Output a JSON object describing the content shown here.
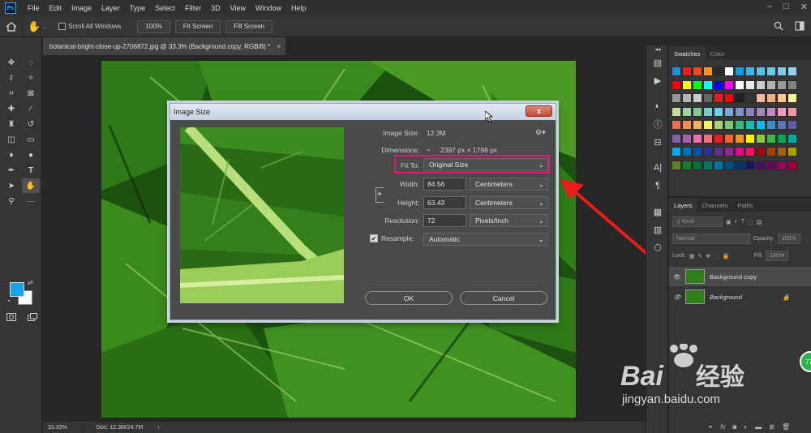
{
  "menubar": {
    "logo": "Ps",
    "items": [
      "File",
      "Edit",
      "Image",
      "Layer",
      "Type",
      "Select",
      "Filter",
      "3D",
      "View",
      "Window",
      "Help"
    ]
  },
  "options": {
    "scroll_all_windows": "Scroll All Windows",
    "zoom_btn": "100%",
    "fit_screen": "Fit Screen",
    "fill_screen": "Fill Screen"
  },
  "document": {
    "tab_title": "botanical-bright-close-up-2706872.jpg @ 33.3% (Background copy, RGB/8) *",
    "close": "×"
  },
  "status": {
    "zoom": "33.33%",
    "doc": "Doc: 12.3M/24.7M",
    "arrow": "›"
  },
  "dialog": {
    "title": "Image Size",
    "close": "x",
    "image_size_label": "Image Size:",
    "image_size_value": "12.3M",
    "dimensions_label": "Dimensions:",
    "dimensions_value": "2397 px  ×  1798 px",
    "fit_to_label": "Fit To:",
    "fit_to_value": "Original Size",
    "width_label": "Width:",
    "width_value": "84.56",
    "width_unit": "Centimeters",
    "height_label": "Height:",
    "height_value": "63.43",
    "height_unit": "Centimeters",
    "resolution_label": "Resolution:",
    "resolution_value": "72",
    "resolution_unit": "Pixels/Inch",
    "resample_label": "Resample:",
    "resample_value": "Automatic",
    "ok": "OK",
    "cancel": "Cancel"
  },
  "panels": {
    "tab_swatches": "Swatches",
    "tab_color": "Color",
    "tab_layers": "Layers",
    "tab_channels": "Channels",
    "tab_paths": "Paths",
    "kind": "Kind",
    "blend_mode": "Normal",
    "opacity_label": "Opacity:",
    "opacity_value": "100%",
    "lock_label": "Lock:",
    "fill_label": "Fill:",
    "fill_value": "100%",
    "layers": [
      {
        "name": "Background copy",
        "selected": true
      },
      {
        "name": "Background",
        "selected": false
      }
    ]
  },
  "watermark": {
    "brand": "Bai",
    "brand_cn": "经验",
    "url": "jingyan.baidu.com",
    "badge": "77"
  },
  "colors": {
    "accent_highlight": "#e0187a",
    "foreground": "#1aa3e8",
    "background": "#ffffff",
    "arrow": "#e81c1c"
  }
}
